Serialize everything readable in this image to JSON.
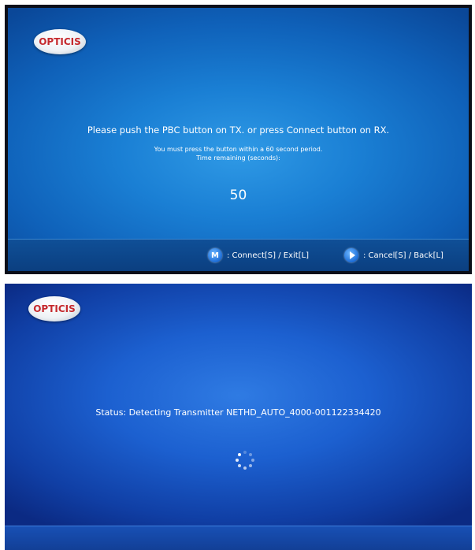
{
  "top_screen": {
    "logo": "OPTICIS",
    "prompt": "Please push the PBC button on TX. or press Connect button on RX.",
    "note_line1": "You must press the button within a 60 second period.",
    "note_line2": "Time remaining (seconds):",
    "countdown": "50",
    "hints": [
      {
        "key_label": "M",
        "text": ": Connect[S] / Exit[L]"
      },
      {
        "key_icon": "play-icon",
        "text": ": Cancel[S] / Back[L]"
      }
    ]
  },
  "bottom_screen": {
    "logo": "OPTICIS",
    "status": "Status: Detecting Transmitter NETHD_AUTO_4000-001122334420",
    "spinner_icon": "loading-spinner-icon"
  },
  "colors": {
    "screen_blue": "#1a7fd4",
    "footer_blue": "#0f4f97",
    "logo_red": "#c5292d"
  }
}
